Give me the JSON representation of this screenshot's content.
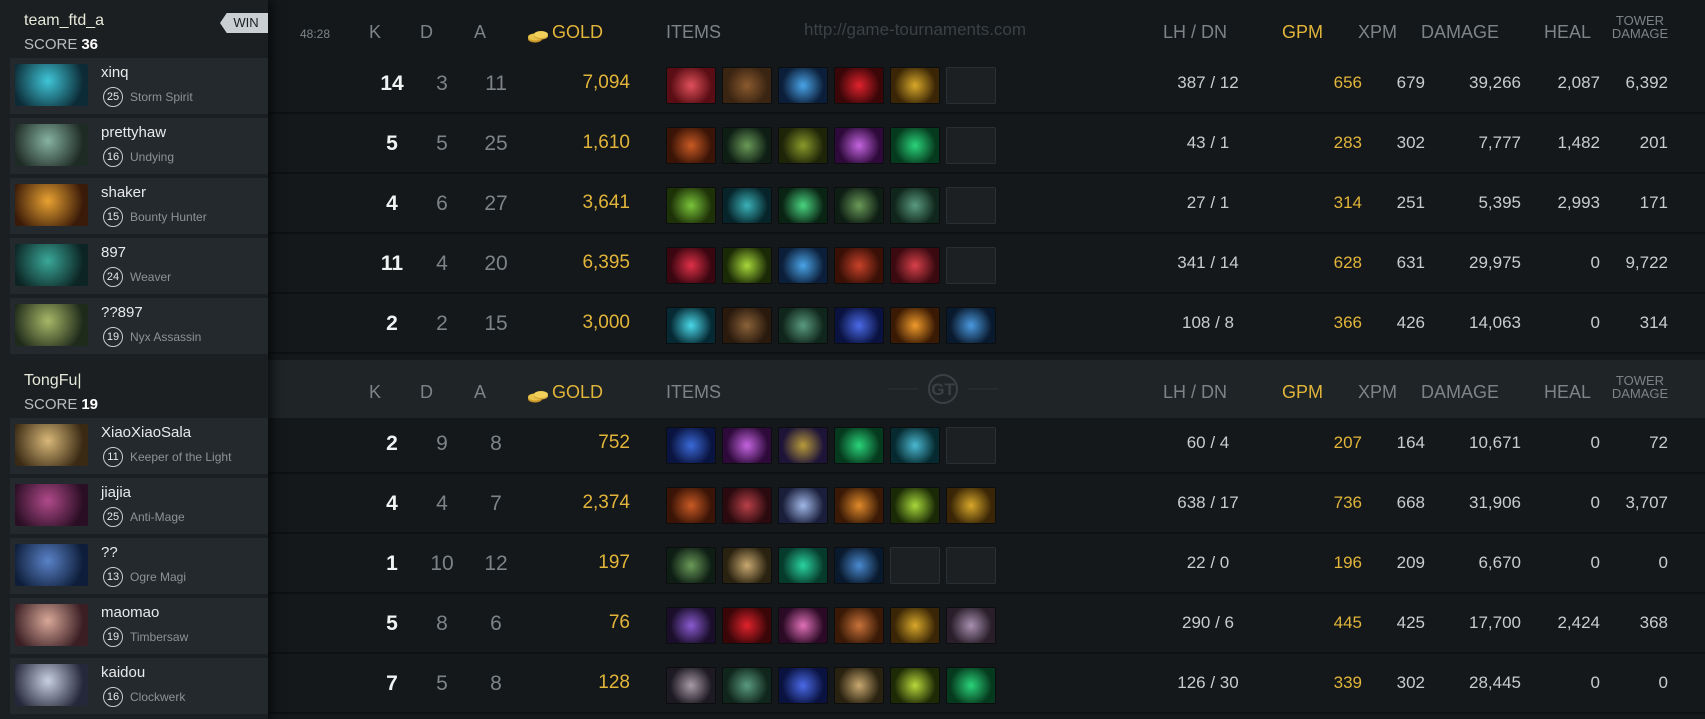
{
  "header": {
    "time": "48:28",
    "watermark": "http://game-tournaments.com",
    "cols": {
      "k": "K",
      "d": "D",
      "a": "A",
      "gold": "GOLD",
      "items": "ITEMS",
      "lhdn": "LH  /  DN",
      "gpm": "GPM",
      "xpm": "XPM",
      "damage": "DAMAGE",
      "heal": "HEAL",
      "tower1": "TOWER",
      "tower2": "DAMAGE"
    }
  },
  "teams": [
    {
      "name": "team_ftd_a",
      "score_label": "SCORE",
      "score": "36",
      "badge": "WIN",
      "players": [
        {
          "name": "xinq",
          "level": "25",
          "hero": "Storm Spirit",
          "k": "14",
          "d": "3",
          "a": "11",
          "gold": "7,094",
          "lhdn": "387  /  12",
          "gpm": "656",
          "xpm": "679",
          "damage": "39,266",
          "heal": "2,087",
          "tower": "6,392",
          "portrait": [
            "#0c2b36",
            "#3fc6d8"
          ],
          "items": [
            [
              "#5a0d14",
              "#e0505a"
            ],
            [
              "#3a2412",
              "#8a5a2e"
            ],
            [
              "#0c1f3a",
              "#4aa4e8"
            ],
            [
              "#3a0608",
              "#e0222c"
            ],
            [
              "#3a2606",
              "#d8a82a"
            ],
            null
          ]
        },
        {
          "name": "prettyhaw",
          "level": "16",
          "hero": "Undying",
          "k": "5",
          "d": "5",
          "a": "25",
          "gold": "1,610",
          "lhdn": "43  /  1",
          "gpm": "283",
          "xpm": "302",
          "damage": "7,777",
          "heal": "1,482",
          "tower": "201",
          "portrait": [
            "#1e2a24",
            "#86b2a2"
          ],
          "items": [
            [
              "#3a1406",
              "#c85a24"
            ],
            [
              "#0e1e14",
              "#6a9a58"
            ],
            [
              "#1e2408",
              "#8a9a2a"
            ],
            [
              "#2e0a3a",
              "#c464e0"
            ],
            [
              "#063a1e",
              "#2ad47a"
            ],
            null
          ]
        },
        {
          "name": "shaker",
          "level": "15",
          "hero": "Bounty Hunter",
          "k": "4",
          "d": "6",
          "a": "27",
          "gold": "3,641",
          "lhdn": "27  /  1",
          "gpm": "314",
          "xpm": "251",
          "damage": "5,395",
          "heal": "2,993",
          "tower": "171",
          "portrait": [
            "#3a1a08",
            "#e8a232"
          ],
          "items": [
            [
              "#1e3208",
              "#7ac43a"
            ],
            [
              "#06242a",
              "#3ab2b8"
            ],
            [
              "#0a2414",
              "#4ad480"
            ],
            [
              "#0e1e14",
              "#6a9a58"
            ],
            [
              "#10261c",
              "#5a9a80"
            ],
            null
          ]
        },
        {
          "name": "897",
          "level": "24",
          "hero": "Weaver",
          "k": "11",
          "d": "4",
          "a": "20",
          "gold": "6,395",
          "lhdn": "341  /  14",
          "gpm": "628",
          "xpm": "631",
          "damage": "29,975",
          "heal": "0",
          "tower": "9,722",
          "portrait": [
            "#0c2424",
            "#3aa898"
          ],
          "items": [
            [
              "#3a0610",
              "#e03048"
            ],
            [
              "#1a2a06",
              "#a8d83a"
            ],
            [
              "#0c1f3a",
              "#4aa4e8"
            ],
            [
              "#3a1006",
              "#c8422a"
            ],
            [
              "#3a0a10",
              "#d8404a"
            ],
            null
          ]
        },
        {
          "name": "??897",
          "level": "19",
          "hero": "Nyx Assassin",
          "k": "2",
          "d": "2",
          "a": "15",
          "gold": "3,000",
          "lhdn": "108  /  8",
          "gpm": "366",
          "xpm": "426",
          "damage": "14,063",
          "heal": "0",
          "tower": "314",
          "portrait": [
            "#1e2a1a",
            "#a8b868"
          ],
          "items": [
            [
              "#062a34",
              "#4ad8e8"
            ],
            [
              "#2a1a0e",
              "#8a6238"
            ],
            [
              "#10261c",
              "#5a9a80"
            ],
            [
              "#0a1240",
              "#4a6ae8"
            ],
            [
              "#3a1a04",
              "#f09a2a"
            ],
            [
              "#0a1a2e",
              "#4a9ae0"
            ]
          ]
        }
      ]
    },
    {
      "name": "TongFu|",
      "score_label": "SCORE",
      "score": "19",
      "badge": "",
      "players": [
        {
          "name": "XiaoXiaoSala",
          "level": "11",
          "hero": "Keeper of the Light",
          "k": "2",
          "d": "9",
          "a": "8",
          "gold": "752",
          "lhdn": "60  /  4",
          "gpm": "207",
          "xpm": "164",
          "damage": "10,671",
          "heal": "0",
          "tower": "72",
          "portrait": [
            "#3a2a14",
            "#d8b878"
          ],
          "items": [
            [
              "#0a1440",
              "#3a6ad8"
            ],
            [
              "#2e0a3a",
              "#c464e0"
            ],
            [
              "#1e1438",
              "#b89a3a"
            ],
            [
              "#063a1e",
              "#2ad47a"
            ],
            [
              "#062a30",
              "#4ab8d0"
            ],
            null
          ]
        },
        {
          "name": "jiajia",
          "level": "25",
          "hero": "Anti-Mage",
          "k": "4",
          "d": "4",
          "a": "7",
          "gold": "2,374",
          "lhdn": "638  /  17",
          "gpm": "736",
          "xpm": "668",
          "damage": "31,906",
          "heal": "0",
          "tower": "3,707",
          "portrait": [
            "#2a0e24",
            "#b04a8a"
          ],
          "items": [
            [
              "#3a1406",
              "#c85a24"
            ],
            [
              "#2a0a0e",
              "#b84048"
            ],
            [
              "#1a1e3a",
              "#a0b8e8"
            ],
            [
              "#3a1a06",
              "#e08a2a"
            ],
            [
              "#1a2a06",
              "#a8d83a"
            ],
            [
              "#3a2606",
              "#d8a82a"
            ]
          ]
        },
        {
          "name": "??",
          "level": "13",
          "hero": "Ogre Magi",
          "k": "1",
          "d": "10",
          "a": "12",
          "gold": "197",
          "lhdn": "22  /  0",
          "gpm": "196",
          "xpm": "209",
          "damage": "6,670",
          "heal": "0",
          "tower": "0",
          "portrait": [
            "#0e1e3a",
            "#5a82c8"
          ],
          "items": [
            [
              "#0e1e14",
              "#6a9a58"
            ],
            [
              "#2a2210",
              "#c8a870"
            ],
            [
              "#063a2a",
              "#2ad4a0"
            ],
            [
              "#0a1a2e",
              "#4a8ad0"
            ],
            null,
            null
          ]
        },
        {
          "name": "maomao",
          "level": "19",
          "hero": "Timbersaw",
          "k": "5",
          "d": "8",
          "a": "6",
          "gold": "76",
          "lhdn": "290  /  6",
          "gpm": "445",
          "xpm": "425",
          "damage": "17,700",
          "heal": "2,424",
          "tower": "368",
          "portrait": [
            "#3a1e24",
            "#d8a898"
          ],
          "items": [
            [
              "#1a0e2a",
              "#8a5ad0"
            ],
            [
              "#3a0608",
              "#e0222c"
            ],
            [
              "#2a0a24",
              "#e070b8"
            ],
            [
              "#3a1a06",
              "#c8723a"
            ],
            [
              "#3a2606",
              "#d8a82a"
            ],
            [
              "#2a1e2a",
              "#a890b0"
            ]
          ]
        },
        {
          "name": "kaidou",
          "level": "16",
          "hero": "Clockwerk",
          "k": "7",
          "d": "5",
          "a": "8",
          "gold": "128",
          "lhdn": "126  /  30",
          "gpm": "339",
          "xpm": "302",
          "damage": "28,445",
          "heal": "0",
          "tower": "0",
          "portrait": [
            "#24283a",
            "#c8d0e0"
          ],
          "items": [
            [
              "#1e1a24",
              "#a89aa8"
            ],
            [
              "#10261c",
              "#5a9a80"
            ],
            [
              "#0a1240",
              "#4a6ae8"
            ],
            [
              "#2a2210",
              "#c8a870"
            ],
            [
              "#1e2a06",
              "#b8d83a"
            ],
            [
              "#063a1e",
              "#2ad47a"
            ]
          ]
        }
      ]
    }
  ]
}
